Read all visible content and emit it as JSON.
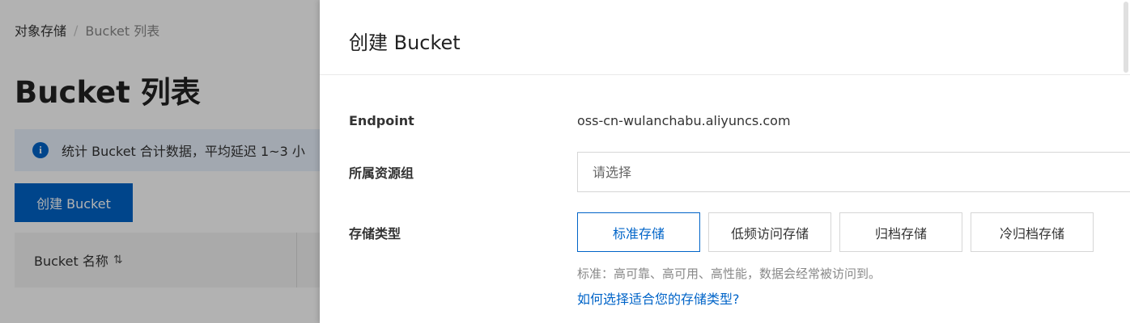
{
  "breadcrumb": {
    "root": "对象存储",
    "separator": "/",
    "current": "Bucket 列表"
  },
  "page": {
    "title": "Bucket 列表",
    "notice": "统计 Bucket 合计数据，平均延迟 1~3 小",
    "create_button": "创建 Bucket",
    "table_header_name": "Bucket 名称",
    "sort_icon": "sort-icon"
  },
  "drawer": {
    "title": "创建 Bucket",
    "endpoint_label": "Endpoint",
    "endpoint_value": "oss-cn-wulanchabu.aliyuncs.com",
    "resource_group_label": "所属资源组",
    "resource_group_placeholder": "请选择",
    "storage_type_label": "存储类型",
    "storage_types": [
      "标准存储",
      "低频访问存储",
      "归档存储",
      "冷归档存储"
    ],
    "storage_type_selected": "标准存储",
    "storage_description": "标准：高可靠、高可用、高性能，数据会经常被访问到。",
    "storage_help_link": "如何选择适合您的存储类型?"
  },
  "colors": {
    "primary": "#0064c8",
    "notice_bg": "#e8f1fd",
    "mask": "rgba(0,0,0,0.3)"
  }
}
